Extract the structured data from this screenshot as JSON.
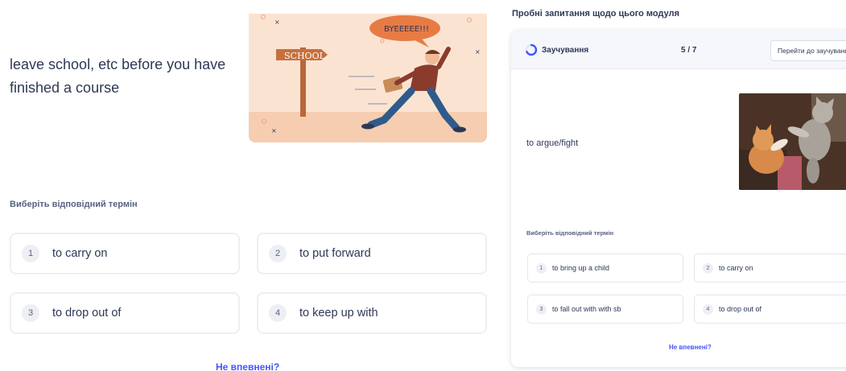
{
  "left": {
    "definition": "leave school, etc before you have finished a course",
    "illustration": {
      "sign_text": "SCHOOL",
      "speech_text": "BYEEEEE!!!"
    },
    "prompt": "Виберіть відповідний термін",
    "options": [
      {
        "number": "1",
        "label": "to carry on"
      },
      {
        "number": "2",
        "label": "to put forward"
      },
      {
        "number": "3",
        "label": "to drop out of"
      },
      {
        "number": "4",
        "label": "to keep up with"
      }
    ],
    "unsure_link": "Не впевнені?"
  },
  "right": {
    "title": "Пробні запитання щодо цього модуля",
    "mode_label": "Заучування",
    "progress": "5 / 7",
    "goto_button": "Перейти до заучування",
    "term": "to argue/fight",
    "prompt": "Виберіть відповідний термін",
    "options": [
      {
        "number": "1",
        "label": "to bring up a child"
      },
      {
        "number": "2",
        "label": "to carry on"
      },
      {
        "number": "3",
        "label": "to fall out with with sb"
      },
      {
        "number": "4",
        "label": "to drop out of"
      }
    ],
    "unsure_link": "Не впевнені?"
  },
  "colors": {
    "accent": "#4255ff",
    "text": "#2e3856",
    "muted": "#586380",
    "border": "#edeff4",
    "illustration_bg": "#fbe3d2"
  },
  "icons": {
    "mode": "learn-mode-icon"
  }
}
